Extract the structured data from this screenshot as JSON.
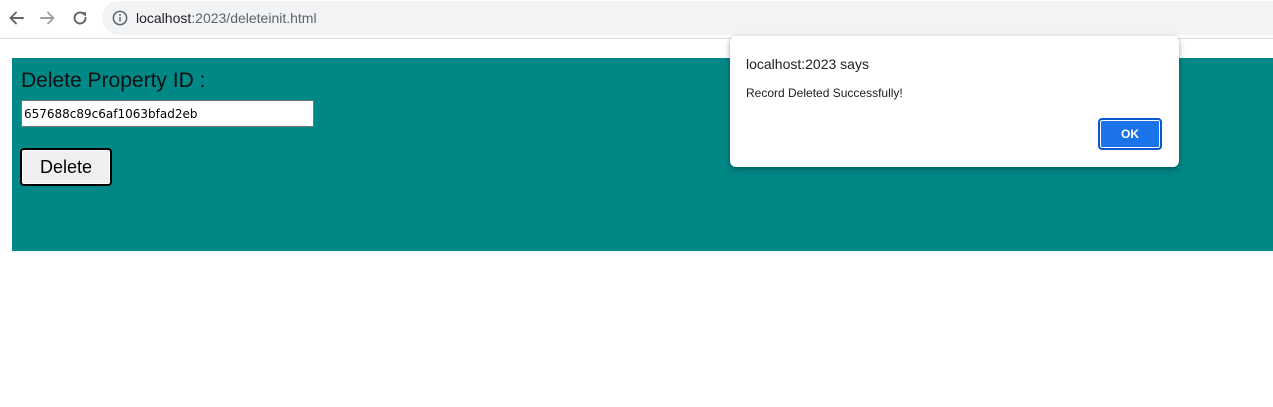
{
  "browser": {
    "url_host": "localhost",
    "url_rest": ":2023/deleteinit.html",
    "icons": {
      "back": "arrow-left-icon",
      "forward": "arrow-right-icon",
      "reload": "reload-icon",
      "site_info": "info-icon"
    }
  },
  "page": {
    "title": "Delete Property ID :",
    "id_value": "657688c89c6af1063bfad2eb",
    "delete_label": "Delete",
    "panel_color": "#008887"
  },
  "dialog": {
    "title": "localhost:2023 says",
    "message": "Record Deleted Successfully!",
    "ok_label": "OK",
    "accent_color": "#1a73e8"
  }
}
